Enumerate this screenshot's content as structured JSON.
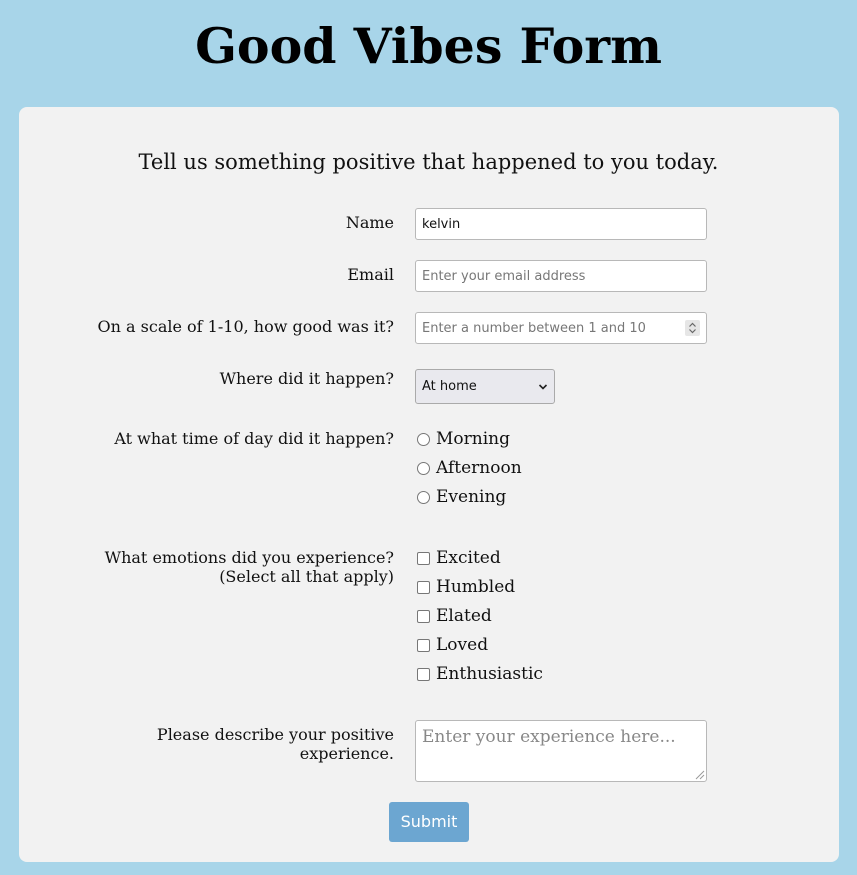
{
  "page": {
    "title": "Good Vibes Form"
  },
  "form": {
    "subtitle": "Tell us something positive that happened to you today.",
    "name": {
      "label": "Name",
      "value": "kelvin"
    },
    "email": {
      "label": "Email",
      "placeholder": "Enter your email address",
      "value": ""
    },
    "scale": {
      "label": "On a scale of 1-10, how good was it?",
      "placeholder": "Enter a number between 1 and 10",
      "value": ""
    },
    "location": {
      "label": "Where did it happen?",
      "selected": "At home"
    },
    "time_of_day": {
      "label": "At what time of day did it happen?",
      "options": [
        "Morning",
        "Afternoon",
        "Evening"
      ]
    },
    "emotions": {
      "label_line1": "What emotions did you experience?",
      "label_line2": "(Select all that apply)",
      "options": [
        "Excited",
        "Humbled",
        "Elated",
        "Loved",
        "Enthusiastic"
      ]
    },
    "description": {
      "label_line1": "Please describe your positive",
      "label_line2": "experience.",
      "placeholder": "Enter your experience here..."
    },
    "submit_label": "Submit"
  },
  "colors": {
    "background": "#a8d5e9",
    "card": "#f2f2f2",
    "submit_button": "#6ca6d1"
  }
}
